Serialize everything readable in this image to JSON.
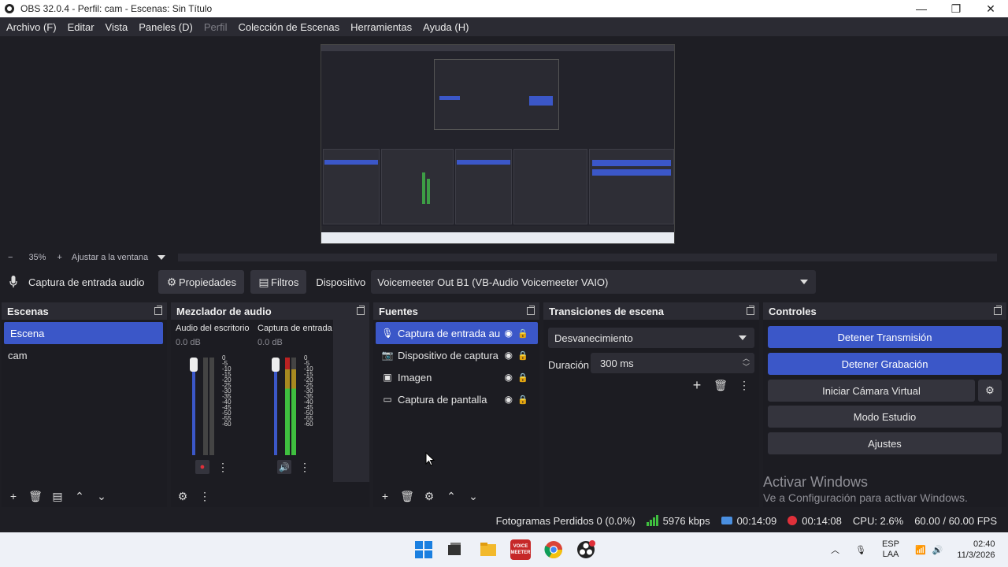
{
  "window": {
    "title": "OBS 32.0.4 - Perfil: cam - Escenas: Sin Título",
    "minimize": "—",
    "maximize": "❐",
    "close": "✕"
  },
  "menu": [
    {
      "label": "Archivo (F)",
      "enabled": true
    },
    {
      "label": "Editar",
      "enabled": true
    },
    {
      "label": "Vista",
      "enabled": true
    },
    {
      "label": "Paneles (D)",
      "enabled": true
    },
    {
      "label": "Perfil",
      "enabled": false
    },
    {
      "label": "Colección de Escenas",
      "enabled": true
    },
    {
      "label": "Herramientas",
      "enabled": true
    },
    {
      "label": "Ayuda (H)",
      "enabled": true
    }
  ],
  "zoombar": {
    "minus": "−",
    "zoom": "35%",
    "plus": "+",
    "fit": "Ajustar a la ventana"
  },
  "source_toolbar": {
    "source_name": "Captura de entrada audio",
    "properties": "Propiedades",
    "filters": "Filtros",
    "device_label": "Dispositivo",
    "device_value": "Voicemeeter Out B1 (VB-Audio Voicemeeter VAIO)"
  },
  "scenes": {
    "title": "Escenas",
    "items": [
      "Escena",
      "cam"
    ],
    "selected": 0
  },
  "mixer": {
    "title": "Mezclador de audio",
    "channels": [
      {
        "name": "Audio del escritorio",
        "db": "0.0 dB",
        "muted": true
      },
      {
        "name": "Captura de entrada audio",
        "db": "0.0 dB",
        "muted": false
      }
    ],
    "scale": [
      "0",
      "-5",
      "-10",
      "-15",
      "-20",
      "-25",
      "-30",
      "-35",
      "-40",
      "-45",
      "-50",
      "-55",
      "-60"
    ]
  },
  "sources": {
    "title": "Fuentes",
    "items": [
      {
        "label": "Captura de entrada au",
        "icon": "microphone-icon"
      },
      {
        "label": "Dispositivo de captura",
        "icon": "camera-icon"
      },
      {
        "label": "Imagen",
        "icon": "image-icon"
      },
      {
        "label": "Captura de pantalla",
        "icon": "monitor-icon"
      }
    ],
    "selected": 0
  },
  "transitions": {
    "title": "Transiciones de escena",
    "selected": "Desvanecimiento",
    "duration_label": "Duración",
    "duration": "300 ms"
  },
  "controls": {
    "title": "Controles",
    "stop_stream": "Detener Transmisión",
    "stop_record": "Detener Grabación",
    "virtual_cam": "Iniciar Cámara Virtual",
    "studio_mode": "Modo Estudio",
    "settings": "Ajustes"
  },
  "activate_windows": {
    "line1": "Activar Windows",
    "line2": "Ve a Configuración para activar Windows."
  },
  "status": {
    "dropped": "Fotogramas Perdidos 0 (0.0%)",
    "bitrate": "5976 kbps",
    "stream_time": "00:14:09",
    "rec_time": "00:14:08",
    "cpu": "CPU: 2.6%",
    "fps": "60.00 / 60.00 FPS"
  },
  "taskbar": {
    "lang1": "ESP",
    "lang2": "LAA",
    "time": "02:40",
    "date": "11/3/2026",
    "vm_label": "VOICE MEETER"
  },
  "colors": {
    "accent": "#3b57c8",
    "record": "#e0303a",
    "meter": "#3fbf3f"
  }
}
